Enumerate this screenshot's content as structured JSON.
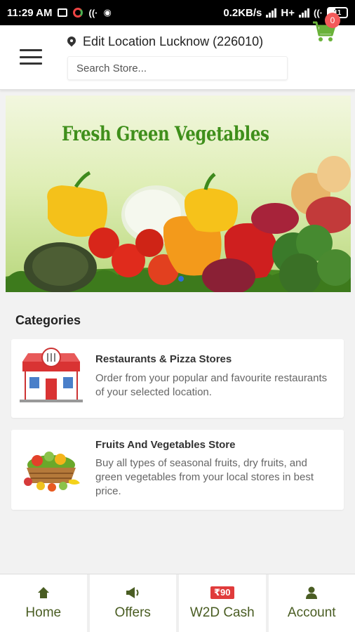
{
  "status_bar": {
    "time": "11:29 AM",
    "network_speed": "0.2KB/s",
    "network_type": "H+",
    "battery_level": "11"
  },
  "header": {
    "location_label": "Edit Location Lucknow (226010)",
    "search_placeholder": "Search Store...",
    "cart_count": "0"
  },
  "banner": {
    "title": "Fresh Green Vegetables"
  },
  "categories": {
    "title": "Categories",
    "items": [
      {
        "name": "Restaurants & Pizza Stores",
        "description": "Order from your popular and favourite restaurants of your selected location.",
        "icon": "restaurant-store-icon"
      },
      {
        "name": "Fruits And Vegetables Store",
        "description": "Buy all types of seasonal fruits, dry fruits, and green vegetables from your local stores in best price.",
        "icon": "fruit-basket-icon"
      }
    ]
  },
  "bottom_nav": {
    "items": [
      {
        "label": "Home",
        "icon": "home-icon"
      },
      {
        "label": "Offers",
        "icon": "megaphone-icon"
      },
      {
        "label": "W2D Cash",
        "icon": "cash-badge",
        "badge": "₹90"
      },
      {
        "label": "Account",
        "icon": "user-icon"
      }
    ]
  },
  "colors": {
    "accent_green": "#4a5d23",
    "cart_green": "#6ab23a",
    "badge_red": "#f45a5a",
    "banner_title_green": "#3f8f1b"
  }
}
